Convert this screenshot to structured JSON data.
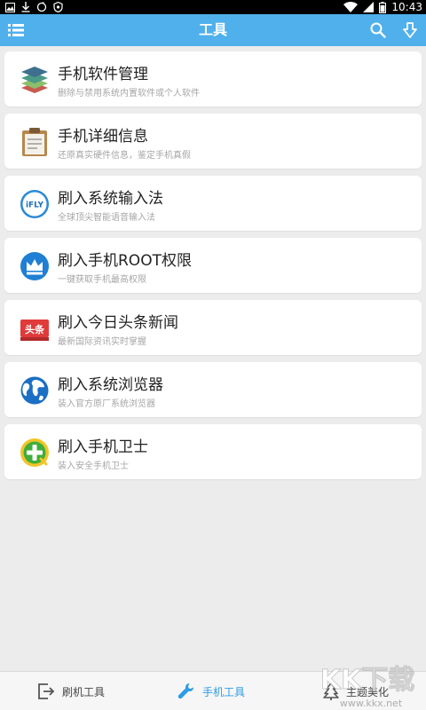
{
  "status_bar": {
    "time": "10:43"
  },
  "header": {
    "title": "工具"
  },
  "tools": [
    {
      "icon": "layers-icon",
      "title": "手机软件管理",
      "subtitle": "删除与禁用系统内置软件或个人软件"
    },
    {
      "icon": "clipboard-icon",
      "title": "手机详细信息",
      "subtitle": "还原真实硬件信息，鉴定手机真假"
    },
    {
      "icon": "ifly-icon",
      "icon_text": "iFLY",
      "title": "刷入系统输入法",
      "subtitle": "全球顶尖智能语音输入法"
    },
    {
      "icon": "crown-icon",
      "title": "刷入手机ROOT权限",
      "subtitle": "一键获取手机最高权限"
    },
    {
      "icon": "toutiao-icon",
      "icon_text": "头条",
      "title": "刷入今日头条新闻",
      "subtitle": "最新国际资讯实时掌握"
    },
    {
      "icon": "globe-icon",
      "title": "刷入系统浏览器",
      "subtitle": "装入官方原厂系统浏览器"
    },
    {
      "icon": "security-plus-icon",
      "title": "刷入手机卫士",
      "subtitle": "装入安全手机卫士"
    }
  ],
  "bottom_nav": [
    {
      "icon": "export-icon",
      "label": "刷机工具",
      "active": false
    },
    {
      "icon": "wrench-icon",
      "label": "手机工具",
      "active": true
    },
    {
      "icon": "tree-icon",
      "label": "主题美化",
      "active": false
    }
  ],
  "watermark": {
    "logo": "KK下载",
    "url": "www.kkx.net"
  },
  "colors": {
    "accent": "#4fb0ec",
    "active_tab": "#2c9de6",
    "background": "#ececec"
  }
}
